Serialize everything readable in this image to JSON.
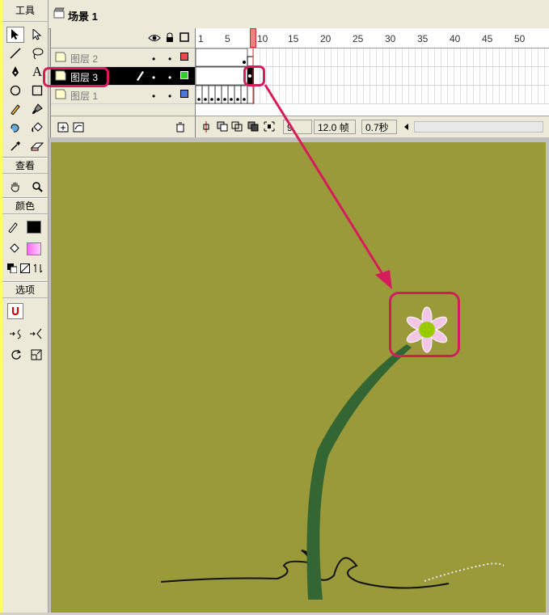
{
  "tools_panel": {
    "title": "工具",
    "view_title": "查看",
    "color_title": "颜色",
    "options_title": "选项",
    "tool_icons": [
      "arrow-icon",
      "subselect-icon",
      "line-icon",
      "lasso-icon",
      "pen-icon",
      "text-icon",
      "oval-icon",
      "rectangle-icon",
      "pencil-icon",
      "brush-icon",
      "ink-bottle-icon",
      "paint-bucket-icon",
      "eyedropper-icon",
      "eraser-icon"
    ],
    "text_tool_glyph": "A",
    "stroke_color": "#000000",
    "fill_color": "#ff88ff"
  },
  "scene": {
    "title": "场景 1"
  },
  "timeline": {
    "layers": [
      {
        "name": "图层 2",
        "color": "#e84a4a"
      },
      {
        "name": "图层 3",
        "color": "#33cc33"
      },
      {
        "name": "图层 1",
        "color": "#4a7ad8"
      }
    ],
    "ruler_ticks": [
      "1",
      "5",
      "10",
      "15",
      "20",
      "25",
      "30",
      "35",
      "40",
      "45",
      "50"
    ],
    "current_frame": "9",
    "frame_rate": "12.0 帧",
    "elapsed_time": "0.7秒"
  },
  "colors": {
    "stage": "#9a9a3a",
    "annotation": "#d61c5c",
    "stem": "#336633",
    "petal": "#f3c6e8",
    "flower_center": "#99cc00"
  }
}
